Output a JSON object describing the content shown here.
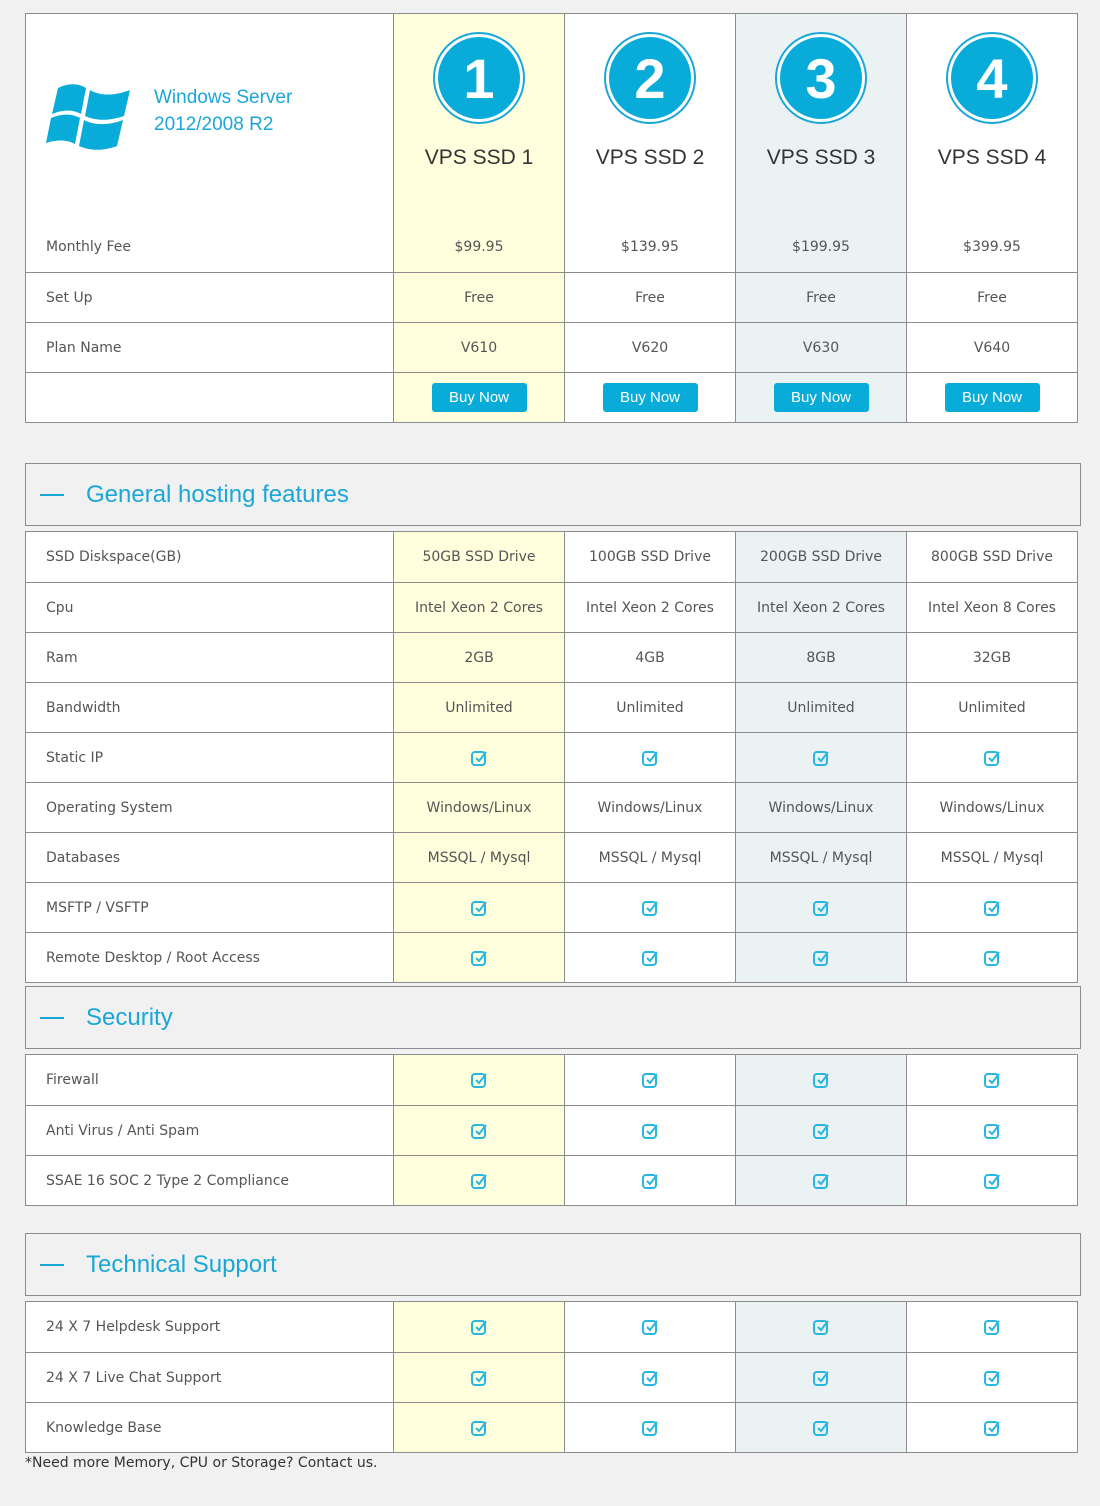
{
  "brand": {
    "line1": "Windows Server",
    "line2": "2012/2008 R2",
    "icon": "windows-logo-icon",
    "color": "#1aa7d8"
  },
  "plans": [
    {
      "number": "1",
      "name": "VPS SSD 1",
      "highlight": "#ffffde"
    },
    {
      "number": "2",
      "name": "VPS SSD 2",
      "highlight": "#ffffff"
    },
    {
      "number": "3",
      "name": "VPS SSD 3",
      "highlight": "#eaf2f4"
    },
    {
      "number": "4",
      "name": "VPS SSD 4",
      "highlight": "#ffffff"
    }
  ],
  "pricing": [
    {
      "label": "Monthly Fee",
      "values": [
        "$99.95",
        "$139.95",
        "$199.95",
        "$399.95"
      ]
    },
    {
      "label": "Set Up",
      "values": [
        "Free",
        "Free",
        "Free",
        "Free"
      ]
    },
    {
      "label": "Plan Name",
      "values": [
        "V610",
        "V620",
        "V630",
        "V640"
      ]
    }
  ],
  "buy_label": "Buy Now",
  "sections": [
    {
      "title": "General hosting features",
      "rows": [
        {
          "label": "SSD Diskspace(GB)",
          "values": [
            "50GB SSD Drive",
            "100GB SSD Drive",
            "200GB SSD Drive",
            "800GB SSD Drive"
          ]
        },
        {
          "label": "Cpu",
          "values": [
            "Intel Xeon 2 Cores",
            "Intel Xeon 2 Cores",
            "Intel Xeon 2 Cores",
            "Intel Xeon 8 Cores"
          ]
        },
        {
          "label": "Ram",
          "values": [
            "2GB",
            "4GB",
            "8GB",
            "32GB"
          ]
        },
        {
          "label": "Bandwidth",
          "values": [
            "Unlimited",
            "Unlimited",
            "Unlimited",
            "Unlimited"
          ]
        },
        {
          "label": "Static IP",
          "values": [
            "check",
            "check",
            "check",
            "check"
          ]
        },
        {
          "label": "Operating System",
          "values": [
            "Windows/Linux",
            "Windows/Linux",
            "Windows/Linux",
            "Windows/Linux"
          ]
        },
        {
          "label": "Databases",
          "values": [
            "MSSQL / Mysql",
            "MSSQL / Mysql",
            "MSSQL / Mysql",
            "MSSQL / Mysql"
          ]
        },
        {
          "label": "MSFTP / VSFTP",
          "values": [
            "check",
            "check",
            "check",
            "check"
          ]
        },
        {
          "label": "Remote Desktop / Root Access",
          "values": [
            "check",
            "check",
            "check",
            "check"
          ]
        }
      ]
    },
    {
      "title": "Security",
      "rows": [
        {
          "label": "Firewall",
          "values": [
            "check",
            "check",
            "check",
            "check"
          ]
        },
        {
          "label": "Anti Virus / Anti Spam",
          "values": [
            "check",
            "check",
            "check",
            "check"
          ]
        },
        {
          "label": "SSAE 16 SOC 2 Type 2 Compliance",
          "values": [
            "check",
            "check",
            "check",
            "check"
          ]
        }
      ]
    },
    {
      "title": "Technical Support",
      "rows": [
        {
          "label": "24 X 7 Helpdesk Support",
          "values": [
            "check",
            "check",
            "check",
            "check"
          ]
        },
        {
          "label": "24 X 7 Live Chat Support",
          "values": [
            "check",
            "check",
            "check",
            "check"
          ]
        },
        {
          "label": "Knowledge Base",
          "values": [
            "check",
            "check",
            "check",
            "check"
          ]
        }
      ]
    }
  ],
  "footnote": "*Need more Memory, CPU or Storage? Contact us.",
  "colors": {
    "accent": "#09acd9",
    "border": "#8c8c8c",
    "page_bg": "#f1f1f1"
  }
}
